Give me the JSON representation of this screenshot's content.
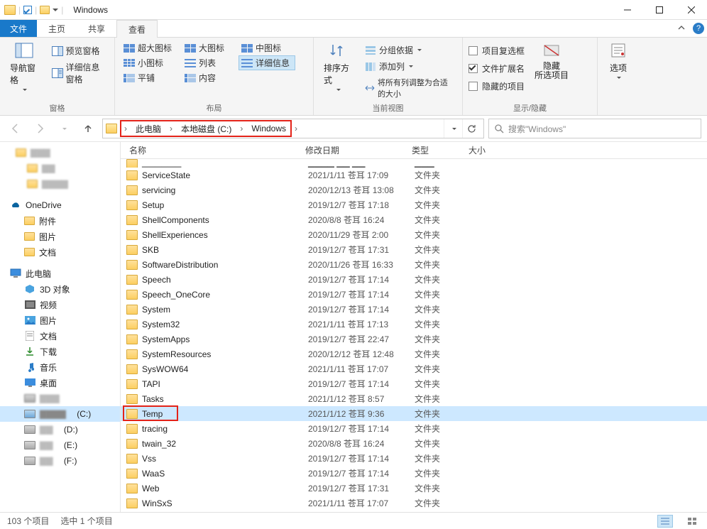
{
  "window": {
    "title": "Windows"
  },
  "tabs": {
    "file": "文件",
    "home": "主页",
    "share": "共享",
    "view": "查看"
  },
  "ribbon": {
    "panes": {
      "nav": "导航窗格",
      "preview": "预览窗格",
      "details": "详细信息窗格",
      "label": "窗格"
    },
    "layout": {
      "xlarge": "超大图标",
      "large": "大图标",
      "medium": "中图标",
      "small": "小图标",
      "list": "列表",
      "details": "详细信息",
      "tiles": "平铺",
      "content": "内容",
      "label": "布局"
    },
    "currentview": {
      "sort": "排序方式",
      "group": "分组依据",
      "addcol": "添加列",
      "fit": "将所有列调整为合适的大小",
      "label": "当前视图"
    },
    "showhide": {
      "itemcheck": "项目复选框",
      "ext": "文件扩展名",
      "hidden": "隐藏的项目",
      "hide": "隐藏\n所选项目",
      "label": "显示/隐藏"
    },
    "options": "选项"
  },
  "breadcrumb": {
    "pc": "此电脑",
    "drive": "本地磁盘 (C:)",
    "folder": "Windows"
  },
  "search": {
    "placeholder": "搜索\"Windows\""
  },
  "tree": {
    "onedrive": "OneDrive",
    "attach": "附件",
    "pics": "图片",
    "docs": "文档",
    "thispc": "此电脑",
    "obj3d": "3D 对象",
    "videos": "视频",
    "pictures": "图片",
    "documents": "文档",
    "downloads": "下载",
    "music": "音乐",
    "desktop": "桌面",
    "drive_c": "(C:)",
    "drive_d": "(D:)",
    "drive_e": "(E:)",
    "drive_f": "(F:)"
  },
  "columns": {
    "name": "名称",
    "date": "修改日期",
    "type": "类型",
    "size": "大小"
  },
  "type_folder": "文件夹",
  "files": [
    {
      "name": "ServiceState",
      "date": "2021/1/11 苍耳 17:09"
    },
    {
      "name": "servicing",
      "date": "2020/12/13 苍耳 13:08"
    },
    {
      "name": "Setup",
      "date": "2019/12/7 苍耳 17:18"
    },
    {
      "name": "ShellComponents",
      "date": "2020/8/8 苍耳 16:24"
    },
    {
      "name": "ShellExperiences",
      "date": "2020/11/29 苍耳 2:00"
    },
    {
      "name": "SKB",
      "date": "2019/12/7 苍耳 17:31"
    },
    {
      "name": "SoftwareDistribution",
      "date": "2020/11/26 苍耳 16:33"
    },
    {
      "name": "Speech",
      "date": "2019/12/7 苍耳 17:14"
    },
    {
      "name": "Speech_OneCore",
      "date": "2019/12/7 苍耳 17:14"
    },
    {
      "name": "System",
      "date": "2019/12/7 苍耳 17:14"
    },
    {
      "name": "System32",
      "date": "2021/1/11 苍耳 17:13"
    },
    {
      "name": "SystemApps",
      "date": "2019/12/7 苍耳 22:47"
    },
    {
      "name": "SystemResources",
      "date": "2020/12/12 苍耳 12:48"
    },
    {
      "name": "SysWOW64",
      "date": "2021/1/11 苍耳 17:07"
    },
    {
      "name": "TAPI",
      "date": "2019/12/7 苍耳 17:14"
    },
    {
      "name": "Tasks",
      "date": "2021/1/12 苍耳 8:57"
    },
    {
      "name": "Temp",
      "date": "2021/1/12 苍耳 9:36",
      "selected": true,
      "boxed": true
    },
    {
      "name": "tracing",
      "date": "2019/12/7 苍耳 17:14"
    },
    {
      "name": "twain_32",
      "date": "2020/8/8 苍耳 16:24"
    },
    {
      "name": "Vss",
      "date": "2019/12/7 苍耳 17:14"
    },
    {
      "name": "WaaS",
      "date": "2019/12/7 苍耳 17:14"
    },
    {
      "name": "Web",
      "date": "2019/12/7 苍耳 17:31"
    },
    {
      "name": "WinSxS",
      "date": "2021/1/11 苍耳 17:07"
    }
  ],
  "status": {
    "count": "103 个项目",
    "selected": "选中 1 个项目"
  }
}
